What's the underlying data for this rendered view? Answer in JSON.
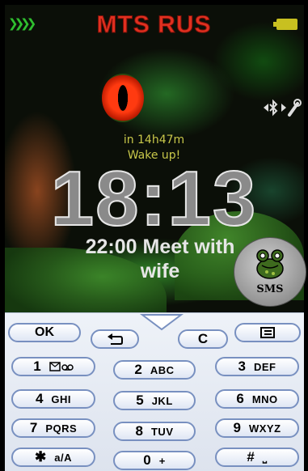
{
  "status_bar": {
    "operator": "MTS RUS",
    "signal_icon": "signal-strength-icon",
    "battery_icon": "battery-icon"
  },
  "connectivity_icon": "bluetooth-icon",
  "alarm": {
    "countdown": "in 14h47m",
    "label": "Wake up!"
  },
  "clock": {
    "time": "18:13"
  },
  "event": {
    "text": "22:00 Meet with wife"
  },
  "sms_button": {
    "label": "SMS",
    "icon": "frog-icon"
  },
  "keypad": {
    "soft_keys": {
      "ok": "OK",
      "back_icon": "back-arrow-icon",
      "nav_icon": "nav-up-arrow-icon",
      "clear": "C",
      "menu_icon": "menu-icon"
    },
    "keys": [
      {
        "num": "1",
        "sub": "voicemail-icon"
      },
      {
        "num": "2",
        "sub": "ABC"
      },
      {
        "num": "3",
        "sub": "DEF"
      },
      {
        "num": "4",
        "sub": "GHI"
      },
      {
        "num": "5",
        "sub": "JKL"
      },
      {
        "num": "6",
        "sub": "MNO"
      },
      {
        "num": "7",
        "sub": "PQRS"
      },
      {
        "num": "8",
        "sub": "TUV"
      },
      {
        "num": "9",
        "sub": "WXYZ"
      },
      {
        "num": "✱",
        "sub": "a/A"
      },
      {
        "num": "0",
        "sub": "+"
      },
      {
        "num": "#",
        "sub": "⎵"
      }
    ]
  },
  "colors": {
    "operator": "#e03020",
    "signal": "#2fbf2f",
    "battery": "#c8c020",
    "alarm_text": "#c8c84a",
    "key_border": "#7890c0"
  }
}
